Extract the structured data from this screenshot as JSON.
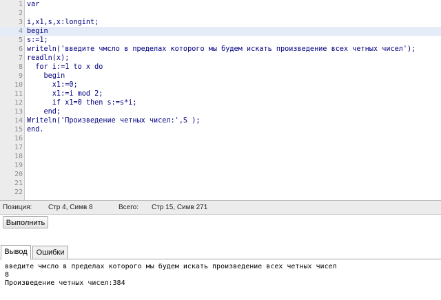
{
  "editor": {
    "active_line": 4,
    "lines": [
      "var",
      "",
      "i,x1,s,x:longint;",
      "begin",
      "s:=1;",
      "writeln('введите чмсло в пределах которого мы будем искать произведение всех четных чисел');",
      "readln(x);",
      "  for i:=1 to x do",
      "    begin",
      "      x1:=0;",
      "      x1:=i mod 2;",
      "      if x1=0 then s:=s*i;",
      "    end;",
      "Writeln('Произведение четных чисел:',S );",
      "end.",
      "",
      "",
      "",
      "",
      "",
      "",
      ""
    ]
  },
  "status": {
    "position_label": "Позиция:",
    "position_value": "Стр 4, Симв 8",
    "total_label": "Всего:",
    "total_value": "Стр 15, Симв 271"
  },
  "toolbar": {
    "run_label": "Выполнить"
  },
  "tabs": [
    {
      "label": "Вывод",
      "active": true
    },
    {
      "label": "Ошибки",
      "active": false
    }
  ],
  "output": {
    "lines": [
      "введите чмсло в пределах которого мы будем искать произведение всех четных чисел",
      "8",
      "Произведение четных чисел:384"
    ]
  }
}
